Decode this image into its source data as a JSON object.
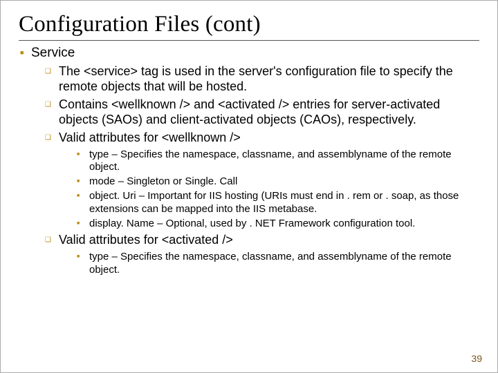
{
  "title": "Configuration Files (cont)",
  "l1": {
    "service": "Service"
  },
  "l2": {
    "a": "The <service> tag is used in the server's configuration file to specify the remote objects that will be hosted.",
    "b": "Contains <wellknown /> and <activated /> entries for server-activated objects (SAOs) and client-activated objects (CAOs), respectively.",
    "c": "Valid attributes for <wellknown />",
    "d": "Valid attributes for <activated />"
  },
  "l3": {
    "wa": "type – Specifies the namespace, classname, and assemblyname of the remote object.",
    "wb": "mode – Singleton or Single. Call",
    "wc": "object. Uri – Important for IIS hosting (URIs must end in . rem or . soap, as those extensions can be mapped into the IIS metabase.",
    "wd": "display. Name – Optional, used by . NET Framework configuration tool.",
    "aa": "type – Specifies the namespace, classname, and assemblyname of the remote object."
  },
  "page_number": "39"
}
